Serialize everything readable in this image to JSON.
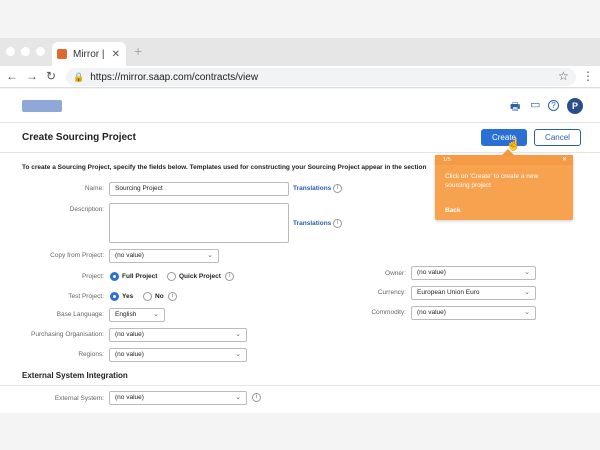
{
  "browser": {
    "tab_title": "Mirror |",
    "tab_close": "✕",
    "new_tab": "+",
    "url": "https://mirror.saap.com/contracts/view"
  },
  "app": {
    "avatar_initial": "P",
    "page_title": "Create Sourcing Project",
    "create_label": "Create",
    "cancel_label": "Cancel",
    "intro": "To create a Sourcing Project, specify the fields below. Templates used for constructing your Sourcing Project appear in the section"
  },
  "form": {
    "name_label": "Name:",
    "name_value": "Sourcing Project",
    "translations": "Translations",
    "description_label": "Description:",
    "copy_label": "Copy from Project:",
    "copy_value": "(no value)",
    "project_label": "Project:",
    "full_project": "Full Project",
    "quick_project": "Quick Project",
    "test_label": "Test Project:",
    "yes": "Yes",
    "no": "No",
    "language_label": "Base Language:",
    "language_value": "English",
    "purchasing_label": "Purchasing Organisation:",
    "purchasing_value": "(no value)",
    "regions_label": "Regions:",
    "regions_value": "(no value)",
    "owner_label": "Owner:",
    "owner_value": "(no value)",
    "currency_label": "Currency:",
    "currency_value": "European Union Euro",
    "commodity_label": "Commodity:",
    "commodity_value": "(no value)"
  },
  "external": {
    "section_title": "External System Integration",
    "system_label": "External System:",
    "system_value": "(no value)"
  },
  "tooltip": {
    "step": "1/5",
    "text": "Click on 'Create' to create a new sourcing project",
    "back": "Back",
    "close": "✕",
    "color": "#f7a24f"
  },
  "icons": {
    "back": "←",
    "forward": "→",
    "reload": "↻",
    "lock": "🔒",
    "star": "☆",
    "menu": "⋮",
    "print": "🖶",
    "chat": "▭",
    "help": "?",
    "info": "i",
    "chevron": "⌄"
  }
}
